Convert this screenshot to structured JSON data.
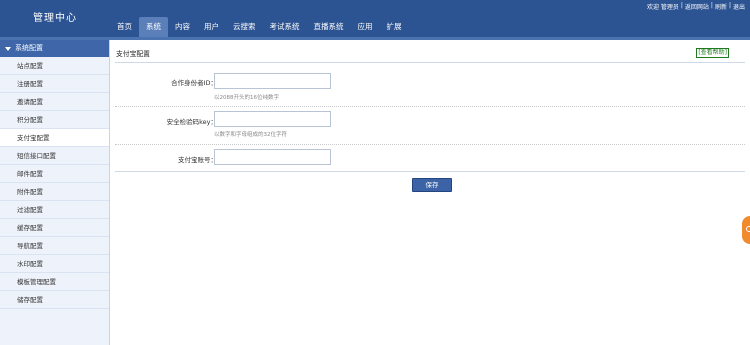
{
  "header": {
    "brand": "管理中心",
    "nav": [
      "首页",
      "系统",
      "内容",
      "用户",
      "云搜索",
      "考试系统",
      "直播系统",
      "应用",
      "扩展"
    ],
    "active_nav": "系统",
    "user_links": [
      "欢迎 管理员",
      "|",
      "返回网站",
      "|",
      "刷新",
      "|",
      "退出"
    ]
  },
  "sidebar": {
    "heading": "系统配置",
    "items": [
      "站点配置",
      "注册配置",
      "邀请配置",
      "积分配置",
      "支付宝配置",
      "短信接口配置",
      "邮件配置",
      "附件配置",
      "过滤配置",
      "缓存配置",
      "导航配置",
      "水印配置",
      "模板管理配置",
      "储存配置"
    ],
    "active_item": "支付宝配置"
  },
  "panel": {
    "title": "支付宝配置",
    "help_link": "[查看帮助]"
  },
  "form": {
    "partner_label": "合作身份者ID：",
    "partner_value": "",
    "partner_hint": "以2088开头的16位纯数字",
    "key_label": "安全检验码key：",
    "key_value": "",
    "key_hint": "以数字和字母组成的32位字符",
    "account_label": "支付宝账号：",
    "account_value": "",
    "save_label": "保存"
  },
  "colors": {
    "header_bg": "#2c5392",
    "sidebar_bg": "#eef3fb",
    "button_bg": "#3b63a5",
    "float_tab": "#f08a2d"
  }
}
